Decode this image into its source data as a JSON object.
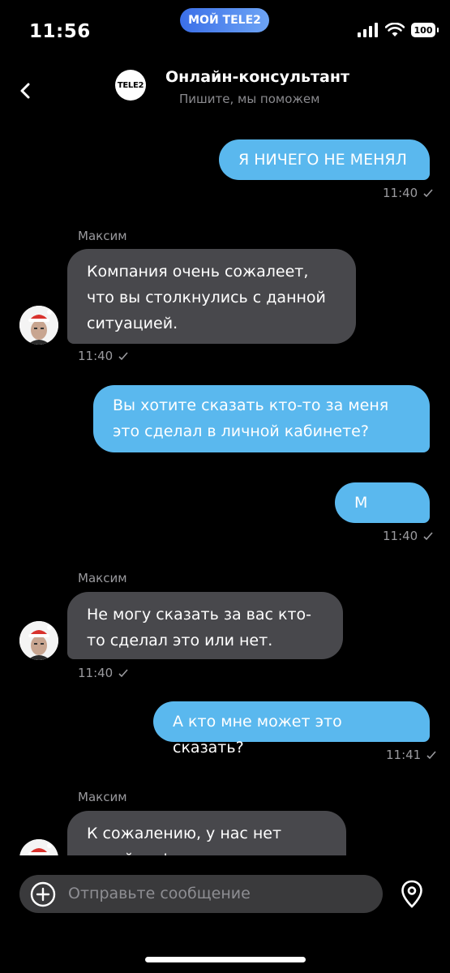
{
  "status_bar": {
    "time": "11:56",
    "carrier_pill": "МОЙ TELE2",
    "battery": "100"
  },
  "header": {
    "back_icon": "chevron-left-icon",
    "logo_text": "TELE2",
    "title": "Онлайн-консультант",
    "subtitle": "Пишите, мы поможем"
  },
  "messages": [
    {
      "from": "user",
      "text": "Я НИЧЕГО НЕ МЕНЯЛ",
      "time": "11:40"
    },
    {
      "from": "agent",
      "sender": "Максим",
      "text": "Компания очень сожалеет, что вы столкнулись с данной ситуацией.",
      "time": "11:40"
    },
    {
      "from": "user",
      "text": "Вы хотите сказать кто-то за меня это сделал в личной кабинете?"
    },
    {
      "from": "user",
      "text": "М",
      "time": "11:40"
    },
    {
      "from": "agent",
      "sender": "Максим",
      "text": "Не могу сказать за вас кто-то сделал это или нет.",
      "time": "11:40"
    },
    {
      "from": "user",
      "text": "А кто мне может это сказать?",
      "time": "11:41"
    },
    {
      "from": "agent",
      "sender": "Максим",
      "text": "К сожалению, у нас нет такой информации"
    }
  ],
  "composer": {
    "placeholder": "Отправьте сообщение",
    "add_icon": "plus-circle-icon",
    "location_icon": "map-pin-icon"
  },
  "colors": {
    "outgoing": "#5ab8ee",
    "incoming": "#48484c",
    "background": "#000000",
    "pill": "#4a85ee"
  }
}
